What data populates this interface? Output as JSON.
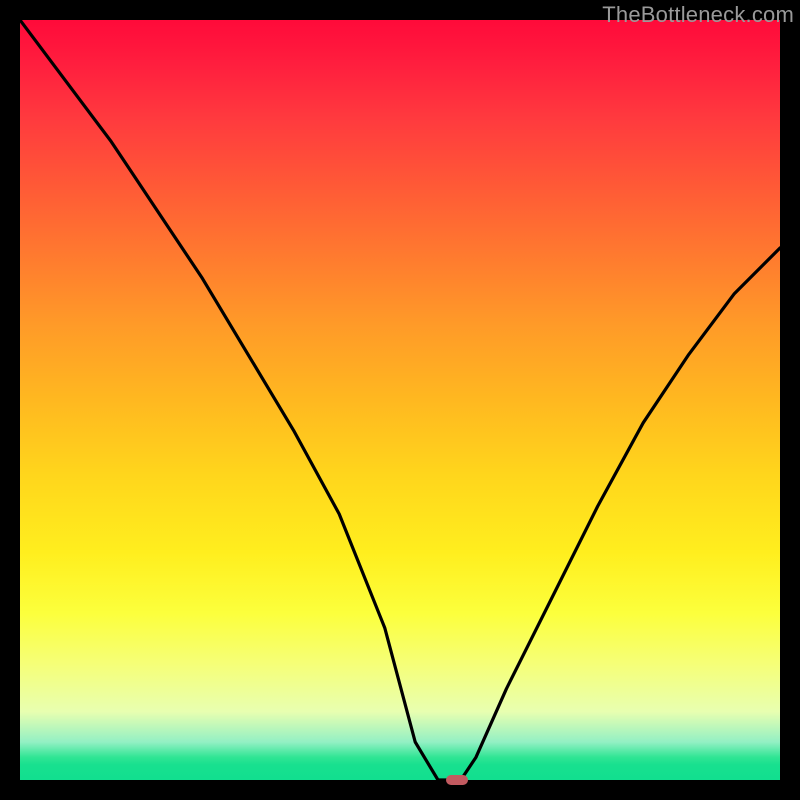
{
  "watermark": {
    "text": "TheBottleneck.com"
  },
  "chart_data": {
    "type": "line",
    "title": "",
    "xlabel": "",
    "ylabel": "",
    "xlim": [
      0,
      100
    ],
    "ylim": [
      0,
      100
    ],
    "gradient_stops": [
      {
        "pct": 0,
        "color": "#ff0a3a"
      },
      {
        "pct": 50,
        "color": "#ffd61c"
      },
      {
        "pct": 90,
        "color": "#f5ff7a"
      },
      {
        "pct": 100,
        "color": "#11df8f"
      }
    ],
    "series": [
      {
        "name": "bottleneck-curve",
        "x": [
          0,
          6,
          12,
          18,
          24,
          30,
          36,
          42,
          48,
          52,
          55,
          58,
          60,
          64,
          70,
          76,
          82,
          88,
          94,
          100
        ],
        "y": [
          100,
          92,
          84,
          75,
          66,
          56,
          46,
          35,
          20,
          5,
          0,
          0,
          3,
          12,
          24,
          36,
          47,
          56,
          64,
          70
        ]
      }
    ],
    "marker": {
      "x": 57.5,
      "y": 0
    }
  }
}
